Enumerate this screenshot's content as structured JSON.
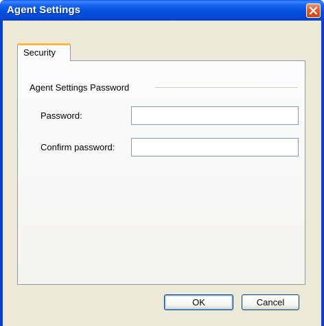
{
  "window": {
    "title": "Agent Settings"
  },
  "tabs": [
    {
      "label": "Security",
      "active": true
    }
  ],
  "group": {
    "label": "Agent Settings Password",
    "fields": {
      "password": {
        "label": "Password:",
        "value": ""
      },
      "confirm": {
        "label": "Confirm password:",
        "value": ""
      }
    }
  },
  "buttons": {
    "ok": "OK",
    "cancel": "Cancel"
  },
  "colors": {
    "titlebar": "#0450df",
    "close_button": "#e45b2d",
    "tab_highlight": "#fcb638",
    "dialog_bg": "#ece9d8"
  }
}
